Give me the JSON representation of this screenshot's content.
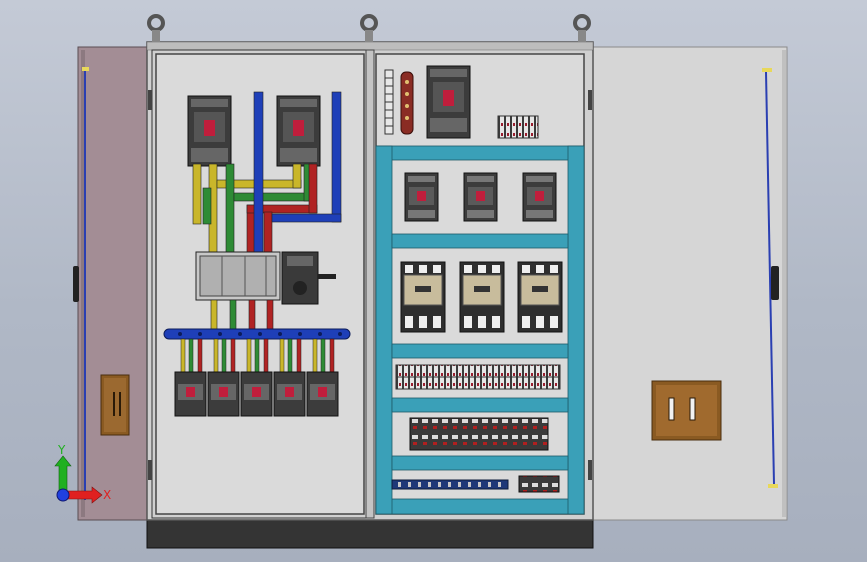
{
  "view": {
    "background_top": "#c4cad6",
    "background_bottom": "#a7afbe"
  },
  "cabinet": {
    "left_door_color": "#a38d95",
    "right_door_color": "#d6d6d6",
    "body_color": "#d0d0d0",
    "plinth_color": "#343434",
    "handle_icon": "handle-icon",
    "lifting_eye_icon": "lifting-eye-icon",
    "hinge_rod_color": "#2a3fb2"
  },
  "wiring_colors": {
    "phase_l1": "#c9b62a",
    "phase_l2": "#2e8b35",
    "phase_l3": "#b02323",
    "neutral": "#1e3fb8"
  },
  "panel_colors": {
    "din_rail_frame": "#3aa0b8",
    "breaker_body": "#3c3c3c",
    "breaker_accent": "#c01e3c",
    "contactor_face": "#c8bc9c"
  },
  "axis_triad": {
    "x_label": "X",
    "y_label": "Y",
    "x_color": "#e02020",
    "y_color": "#20b020",
    "origin_color": "#2040e0"
  }
}
